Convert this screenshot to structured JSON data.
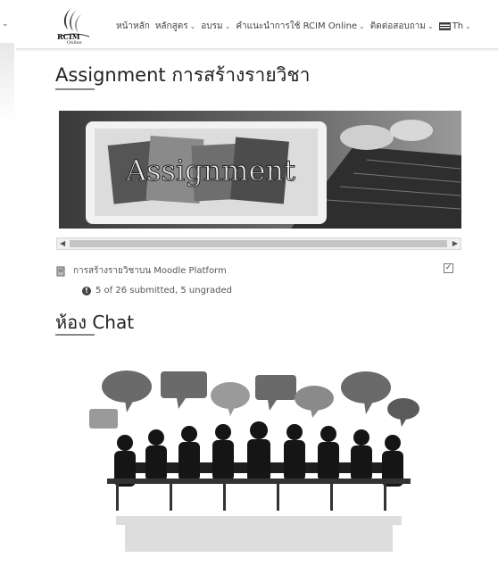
{
  "header": {
    "logo_text": "RCIM",
    "logo_sub": "Online",
    "nav": [
      {
        "label": "หน้าหลัก",
        "has_menu": false
      },
      {
        "label": "หลักสูตร",
        "has_menu": true
      },
      {
        "label": "อบรม",
        "has_menu": true
      },
      {
        "label": "คำแนะนำการใช้ RCIM Online",
        "has_menu": true
      },
      {
        "label": "ติดต่อสอบถาม",
        "has_menu": true
      }
    ],
    "language": "Th"
  },
  "assignment_section": {
    "title": "Assignment การสร้างรายวิชา",
    "banner_text": "Assignment"
  },
  "activity": {
    "label": "การสร้างรายวิชาบน Moodle Platform",
    "status": "5 of 26 submitted, 5 ungraded",
    "completed": true
  },
  "chat_section": {
    "title": "ห้อง Chat"
  },
  "icons": {
    "left_chevron": "chevron-down-icon",
    "activity_icon": "assignment-icon",
    "info_icon": "info-icon",
    "completion_icon": "checkbox-checked-icon",
    "flag": "language-flag-icon"
  }
}
